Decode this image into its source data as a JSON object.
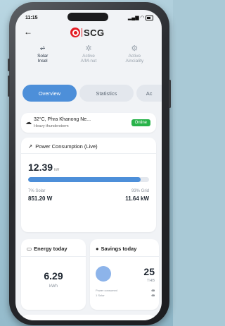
{
  "status": {
    "time": "11:15"
  },
  "brand": {
    "name": "SCG"
  },
  "modes": [
    {
      "label1": "Solar",
      "label2": "Insel",
      "icon": "solar-panel-icon",
      "active": true
    },
    {
      "label1": "Active",
      "label2": "A/M-nut",
      "icon": "fan-icon",
      "active": false
    },
    {
      "label1": "Active",
      "label2": "Ainciality",
      "icon": "settings-flow-icon",
      "active": false
    }
  ],
  "tabs": [
    "Overview",
    "Statistics",
    "Ac"
  ],
  "weather": {
    "title": "32°C, Phra Khanong Ne...",
    "subtitle": "Heavy thunderstorm",
    "badge": "Online"
  },
  "power": {
    "title": "Power Consumption (Live)",
    "value": "12.39",
    "unit": "kW",
    "solar_percent": 0.07,
    "left_label": "7% Solar",
    "right_label": "93% Grid",
    "left_value": "851.20 W",
    "right_value": "11.64 kW"
  },
  "energy": {
    "title": "Energy today",
    "value": "6.29",
    "unit": "kWh"
  },
  "savings": {
    "title": "Savings today",
    "value": "25",
    "unit": "THB",
    "row1_label": "Power consumed",
    "row1_value": "60",
    "row2_label": "1 Solar",
    "row2_value": "60"
  },
  "colors": {
    "accent": "#4d8fd9",
    "brand": "#e31b23",
    "online": "#29b34a"
  }
}
